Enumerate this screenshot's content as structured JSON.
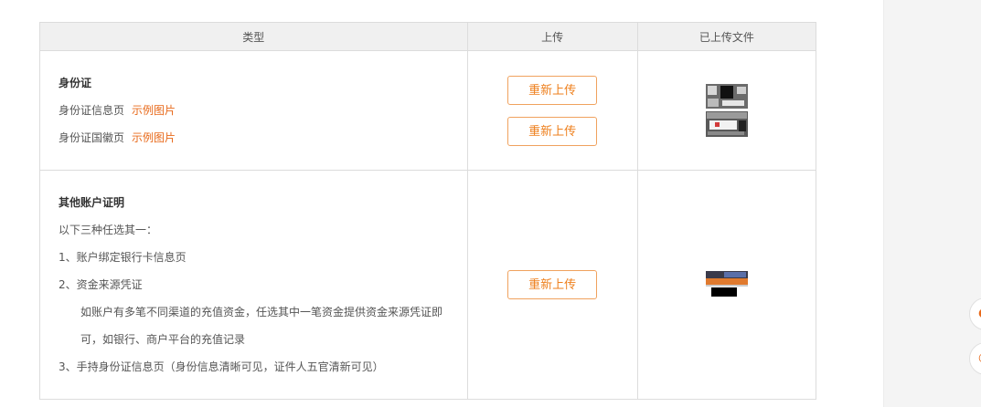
{
  "table": {
    "headers": {
      "type": "类型",
      "upload": "上传",
      "uploaded_files": "已上传文件"
    },
    "rows": [
      {
        "title": "身份证",
        "lines": [
          {
            "text": "身份证信息页",
            "link": "示例图片"
          },
          {
            "text": "身份证国徽页",
            "link": "示例图片"
          }
        ],
        "buttons": [
          "重新上传",
          "重新上传"
        ]
      },
      {
        "title": "其他账户证明",
        "lines": [
          {
            "text": "以下三种任选其一："
          },
          {
            "text": "1、账户绑定银行卡信息页"
          },
          {
            "text": "2、资金来源凭证"
          },
          {
            "text": "如账户有多笔不同渠道的充值资金，任选其中一笔资金提供资金来源凭证即"
          },
          {
            "text": "可，如银行、商户平台的充值记录"
          },
          {
            "text": "3、手持身份证信息页（身份信息清晰可见，证件人五官清新可见）"
          }
        ],
        "buttons": [
          "重新上传"
        ]
      }
    ]
  },
  "colors": {
    "accent": "#e8691a",
    "button_border": "#f0a25e",
    "header_bg": "#f0f0f0",
    "border": "#dcdcdc",
    "side_panel_bg": "#f4f4f4"
  },
  "icons": {
    "floating_buttons": [
      "support-icon",
      "feedback-icon"
    ]
  }
}
